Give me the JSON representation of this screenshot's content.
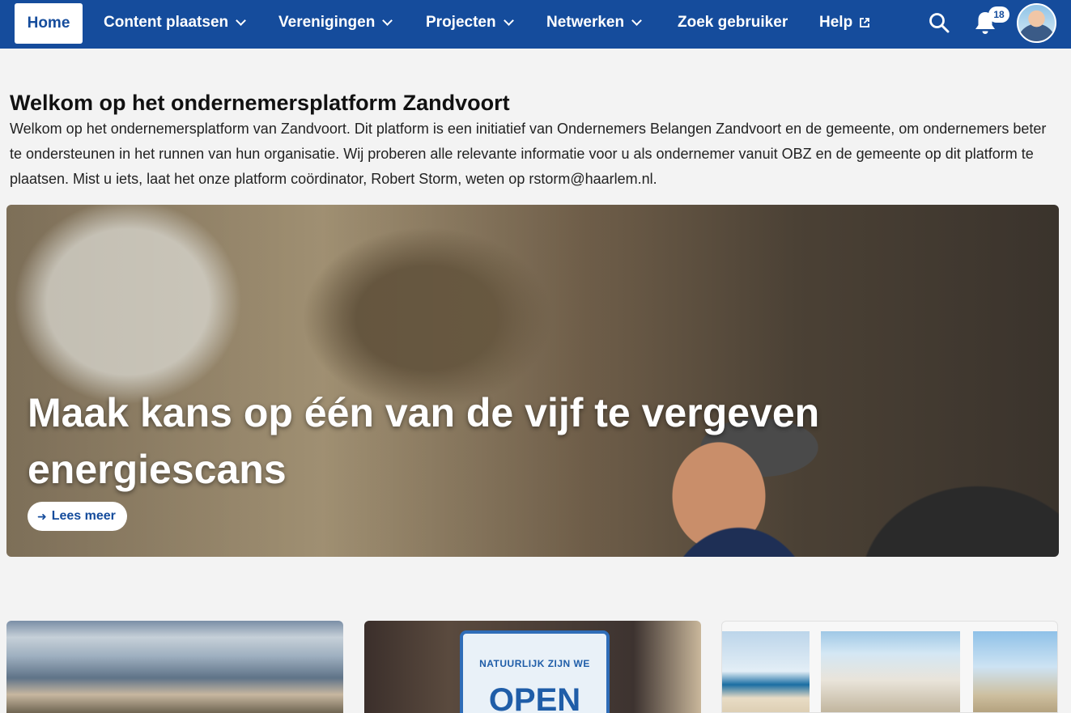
{
  "nav": {
    "home": "Home",
    "items": [
      {
        "label": "Content plaatsen"
      },
      {
        "label": "Verenigingen"
      },
      {
        "label": "Projecten"
      },
      {
        "label": "Netwerken"
      },
      {
        "label": "Zoek gebruiker"
      },
      {
        "label": "Help"
      }
    ],
    "notification_count": "18",
    "icons": {
      "search": "search-icon",
      "bell": "bell-icon",
      "external": "external-link-icon"
    },
    "colors": {
      "bar": "#154c9c",
      "active_bg": "#ffffff",
      "active_text": "#154c9c"
    }
  },
  "intro": {
    "title": "Welkom op het ondernemersplatform Zandvoort",
    "body": "Welkom op het ondernemersplatform van Zandvoort. Dit platform is een initiatief van Ondernemers Belangen Zandvoort en de gemeente, om ondernemers beter te ondersteunen in het runnen van hun organisatie. Wij proberen alle relevante informatie voor u als ondernemer vanuit OBZ en de gemeente op dit platform te plaatsen. Mist u iets, laat het onze platform coördinator, Robert Storm, weten op rstorm@haarlem.nl."
  },
  "hero": {
    "title": "Maak kans op één van de vijf te vergeven energiescans",
    "button": "Lees meer"
  },
  "cards": [
    {
      "sign_top": "",
      "sign_big": ""
    },
    {
      "sign_top": "NATUURLIJK ZIJN WE",
      "sign_big": "OPEN"
    },
    {
      "sign_top": "",
      "sign_big": ""
    }
  ]
}
